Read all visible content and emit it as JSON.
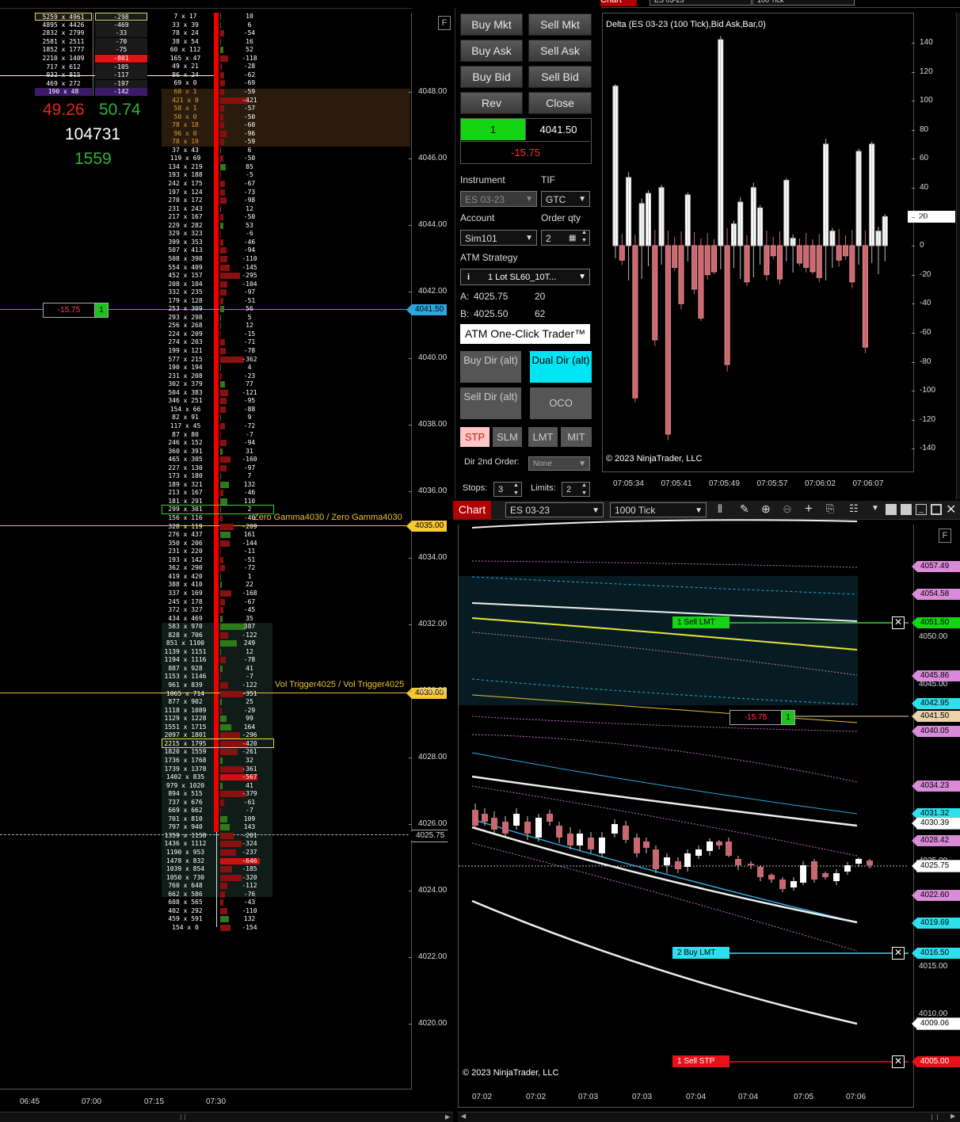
{
  "left_panel": {
    "time_axis": [
      "06:45",
      "07:00",
      "07:15",
      "07:30"
    ],
    "price_axis": [
      "4048.00",
      "4046.00",
      "4044.00",
      "4042.00",
      "4040.00",
      "4038.00",
      "4036.00",
      "4034.00",
      "4032.00",
      "4030.00",
      "4028.00",
      "4026.00",
      "4024.00",
      "4022.00",
      "4020.00"
    ],
    "current_price": "4041.50",
    "last_price": "4025.75",
    "zero_gamma_price": "4035.00",
    "vol_trigger_price": "4030.00",
    "zero_gamma_label": "Zero Gamma4030 / Zero Gamma4030",
    "vol_trigger_label": "Vol Trigger4025 / Vol Trigger4025",
    "position_pnl": "-15.75",
    "position_qty": "1",
    "f_button": "F",
    "stats": {
      "sell_pct": "49.26",
      "buy_pct": "50.74",
      "volume": "104731",
      "delta_total": "1559"
    },
    "time_and_sales": [
      {
        "bidask": "5259 x 4961",
        "delta": "-298"
      },
      {
        "bidask": "4895 x 4426",
        "delta": "-469"
      },
      {
        "bidask": "2832 x 2799",
        "delta": "-33"
      },
      {
        "bidask": "2581 x 2511",
        "delta": "-70"
      },
      {
        "bidask": "1852 x 1777",
        "delta": "-75"
      },
      {
        "bidask": "2210 x 1409",
        "delta": "-801"
      },
      {
        "bidask": "717 x 612",
        "delta": "-105"
      },
      {
        "bidask": "932 x 815",
        "delta": "-117"
      },
      {
        "bidask": "469 x 272",
        "delta": "-197"
      },
      {
        "bidask": "190 x 48",
        "delta": "-142"
      }
    ],
    "ladder": [
      {
        "ba": "7 x 17",
        "d": "10"
      },
      {
        "ba": "33 x 39",
        "d": "6"
      },
      {
        "ba": "78 x 24",
        "d": "-54"
      },
      {
        "ba": "38 x 54",
        "d": "16"
      },
      {
        "ba": "60 x 112",
        "d": "52"
      },
      {
        "ba": "165 x 47",
        "d": "-118"
      },
      {
        "ba": "49 x 21",
        "d": "-28"
      },
      {
        "ba": "86 x 24",
        "d": "-62"
      },
      {
        "ba": "69 x 0",
        "d": "-69"
      },
      {
        "ba": "60 x 1",
        "d": "-59"
      },
      {
        "ba": "421 x 0",
        "d": "-421"
      },
      {
        "ba": "58 x 1",
        "d": "-57"
      },
      {
        "ba": "50 x 0",
        "d": "-50"
      },
      {
        "ba": "78 x 18",
        "d": "-60"
      },
      {
        "ba": "96 x 0",
        "d": "-96"
      },
      {
        "ba": "78 x 19",
        "d": "-59"
      },
      {
        "ba": "37 x 43",
        "d": "6"
      },
      {
        "ba": "119 x 69",
        "d": "-50"
      },
      {
        "ba": "134 x 219",
        "d": "85"
      },
      {
        "ba": "193 x 188",
        "d": "-5"
      },
      {
        "ba": "242 x 175",
        "d": "-67"
      },
      {
        "ba": "197 x 124",
        "d": "-73"
      },
      {
        "ba": "270 x 172",
        "d": "-98"
      },
      {
        "ba": "231 x 243",
        "d": "12"
      },
      {
        "ba": "217 x 167",
        "d": "-50"
      },
      {
        "ba": "229 x 282",
        "d": "53"
      },
      {
        "ba": "329 x 323",
        "d": "-6"
      },
      {
        "ba": "399 x 353",
        "d": "-46"
      },
      {
        "ba": "507 x 413",
        "d": "-94"
      },
      {
        "ba": "508 x 398",
        "d": "-110"
      },
      {
        "ba": "554 x 409",
        "d": "-145"
      },
      {
        "ba": "452 x 157",
        "d": "-295"
      },
      {
        "ba": "208 x 104",
        "d": "-104"
      },
      {
        "ba": "332 x 235",
        "d": "-97"
      },
      {
        "ba": "179 x 128",
        "d": "-51"
      },
      {
        "ba": "253 x 309",
        "d": "56"
      },
      {
        "ba": "293 x 298",
        "d": "5"
      },
      {
        "ba": "256 x 268",
        "d": "12"
      },
      {
        "ba": "224 x 209",
        "d": "-15"
      },
      {
        "ba": "274 x 203",
        "d": "-71"
      },
      {
        "ba": "199 x 121",
        "d": "-78"
      },
      {
        "ba": "577 x 215",
        "d": "-362"
      },
      {
        "ba": "190 x 194",
        "d": "4"
      },
      {
        "ba": "231 x 208",
        "d": "-23"
      },
      {
        "ba": "302 x 379",
        "d": "77"
      },
      {
        "ba": "504 x 383",
        "d": "-121"
      },
      {
        "ba": "346 x 251",
        "d": "-95"
      },
      {
        "ba": "154 x 66",
        "d": "-88"
      },
      {
        "ba": "82 x 91",
        "d": "9"
      },
      {
        "ba": "117 x 45",
        "d": "-72"
      },
      {
        "ba": "87 x 80",
        "d": "-7"
      },
      {
        "ba": "246 x 152",
        "d": "-94"
      },
      {
        "ba": "360 x 391",
        "d": "31"
      },
      {
        "ba": "465 x 305",
        "d": "-160"
      },
      {
        "ba": "227 x 130",
        "d": "-97"
      },
      {
        "ba": "173 x 180",
        "d": "7"
      },
      {
        "ba": "189 x 321",
        "d": "132"
      },
      {
        "ba": "213 x 167",
        "d": "-46"
      },
      {
        "ba": "181 x 291",
        "d": "110"
      },
      {
        "ba": "299 x 301",
        "d": "2"
      },
      {
        "ba": "156 x 116",
        "d": "-40"
      },
      {
        "ba": "328 x 119",
        "d": "-209"
      },
      {
        "ba": "276 x 437",
        "d": "161"
      },
      {
        "ba": "350 x 206",
        "d": "-144"
      },
      {
        "ba": "231 x 220",
        "d": "-11"
      },
      {
        "ba": "193 x 142",
        "d": "-51"
      },
      {
        "ba": "362 x 290",
        "d": "-72"
      },
      {
        "ba": "419 x 420",
        "d": "1"
      },
      {
        "ba": "388 x 410",
        "d": "22"
      },
      {
        "ba": "337 x 169",
        "d": "-168"
      },
      {
        "ba": "245 x 178",
        "d": "-67"
      },
      {
        "ba": "372 x 327",
        "d": "-45"
      },
      {
        "ba": "434 x 469",
        "d": "35"
      },
      {
        "ba": "583 x 970",
        "d": "387"
      },
      {
        "ba": "828 x 706",
        "d": "-122"
      },
      {
        "ba": "851 x 1100",
        "d": "249"
      },
      {
        "ba": "1139 x 1151",
        "d": "12"
      },
      {
        "ba": "1194 x 1116",
        "d": "-78"
      },
      {
        "ba": "887 x 928",
        "d": "41"
      },
      {
        "ba": "1153 x 1146",
        "d": "-7"
      },
      {
        "ba": "961 x 839",
        "d": "-122"
      },
      {
        "ba": "1065 x 714",
        "d": "-351"
      },
      {
        "ba": "877 x 902",
        "d": "25"
      },
      {
        "ba": "1118 x 1089",
        "d": "-29"
      },
      {
        "ba": "1129 x 1228",
        "d": "99"
      },
      {
        "ba": "1551 x 1715",
        "d": "164"
      },
      {
        "ba": "2097 x 1801",
        "d": "-296"
      },
      {
        "ba": "2215 x 1795",
        "d": "-420"
      },
      {
        "ba": "1820 x 1559",
        "d": "-261"
      },
      {
        "ba": "1736 x 1768",
        "d": "32"
      },
      {
        "ba": "1739 x 1378",
        "d": "-361"
      },
      {
        "ba": "1402 x 835",
        "d": "-567"
      },
      {
        "ba": "979 x 1020",
        "d": "41"
      },
      {
        "ba": "894 x 515",
        "d": "-379"
      },
      {
        "ba": "737 x 676",
        "d": "-61"
      },
      {
        "ba": "669 x 662",
        "d": "-7"
      },
      {
        "ba": "701 x 810",
        "d": "109"
      },
      {
        "ba": "797 x 940",
        "d": "143"
      },
      {
        "ba": "1359 x 1158",
        "d": "-201"
      },
      {
        "ba": "1436 x 1112",
        "d": "-324"
      },
      {
        "ba": "1190 x 953",
        "d": "-237"
      },
      {
        "ba": "1478 x 832",
        "d": "-646"
      },
      {
        "ba": "1039 x 854",
        "d": "-185"
      },
      {
        "ba": "1050 x 730",
        "d": "-320"
      },
      {
        "ba": "760 x 648",
        "d": "-112"
      },
      {
        "ba": "662 x 586",
        "d": "-76"
      },
      {
        "ba": "608 x 565",
        "d": "-43"
      },
      {
        "ba": "402 x 292",
        "d": "-110"
      },
      {
        "ba": "459 x 591",
        "d": "132"
      },
      {
        "ba": "154 x 0",
        "d": "-154"
      }
    ]
  },
  "trade_panel": {
    "buy_mkt": "Buy Mkt",
    "sell_mkt": "Sell Mkt",
    "buy_ask": "Buy Ask",
    "sell_ask": "Sell Ask",
    "buy_bid": "Buy Bid",
    "sell_bid": "Sell Bid",
    "rev": "Rev",
    "close": "Close",
    "pos_qty": "1",
    "pos_price": "4041.50",
    "pos_pnl": "-15.75",
    "instrument_label": "Instrument",
    "instrument_value": "ES 03-23",
    "tif_label": "TIF",
    "tif_value": "GTC",
    "account_label": "Account",
    "account_value": "Sim101",
    "qty_label": "Order qty",
    "qty_value": "2",
    "atm_label": "ATM Strategy",
    "atm_value": "1 Lot  SL60_10T...",
    "atm_info": "i",
    "ask_label": "A:",
    "ask_price": "4025.75",
    "ask_size": "20",
    "bid_label": "B:",
    "bid_price": "4025.50",
    "bid_size": "62",
    "one_click": "ATM One-Click Trader™",
    "buy_dir": "Buy Dir (alt)",
    "dual_dir": "Dual Dir (alt)",
    "sell_dir": "Sell Dir (alt)",
    "oco": "OCO",
    "stp": "STP",
    "slm": "SLM",
    "lmt": "LMT",
    "mit": "MIT",
    "dir2_label": "Dir 2nd Order:",
    "dir2_value": "None",
    "stops_label": "Stops:",
    "stops_value": "3",
    "limits_label": "Limits:",
    "limits_value": "2"
  },
  "delta_chart": {
    "tab": "Chart",
    "top_instrument": "ES 03-23",
    "top_interval": "100 Tick",
    "title": "Delta (ES 03-23 (100 Tick),Bid Ask,Bar,0)",
    "copyright": "© 2023 NinjaTrader, LLC",
    "current_label": "20",
    "y_ticks": [
      "140",
      "120",
      "100",
      "80",
      "60",
      "40",
      "20",
      "0",
      "-20",
      "-40",
      "-60",
      "-80",
      "-100",
      "-120",
      "-140"
    ],
    "x_ticks": [
      "07:05:34",
      "07:05:41",
      "07:05:49",
      "07:05:57",
      "07:06:02",
      "07:06:07"
    ]
  },
  "chart_data": {
    "type": "bar",
    "title": "Delta (ES 03-23 (100 Tick),Bid Ask,Bar,0)",
    "ylim": [
      -150,
      150
    ],
    "values": [
      110,
      -10,
      47,
      -105,
      29,
      36,
      -65,
      40,
      -130,
      -15,
      -40,
      35,
      -30,
      -50,
      -20,
      -18,
      142,
      -82,
      15,
      30,
      -25,
      40,
      26,
      -20,
      -7,
      -23,
      45,
      5,
      -12,
      -15,
      -18,
      -22,
      70,
      10,
      -10,
      -7,
      -25,
      65,
      -70,
      70,
      10,
      20
    ]
  },
  "price_chart": {
    "tab": "Chart",
    "instrument": "ES 03-23",
    "interval": "1000 Tick",
    "copyright": "© 2023 NinjaTrader, LLC",
    "f_button": "F",
    "x_ticks": [
      "07:02",
      "07:02",
      "07:03",
      "07:03",
      "07:04",
      "07:04",
      "07:05",
      "07:06"
    ],
    "price_axis": [
      "4050.00",
      "4045.00",
      "4025.00",
      "4015.00",
      "4010.00"
    ],
    "tags": [
      {
        "v": "4057.49"
      },
      {
        "v": "4054.58"
      },
      {
        "v": "4051.50"
      },
      {
        "v": "4045.86"
      },
      {
        "v": "4042.95"
      },
      {
        "v": "4041.50"
      },
      {
        "v": "4040.05"
      },
      {
        "v": "4034.23"
      },
      {
        "v": "4031.32"
      },
      {
        "v": "4030.39"
      },
      {
        "v": "4028.42"
      },
      {
        "v": "4025.75"
      },
      {
        "v": "4022.60"
      },
      {
        "v": "4019.69"
      },
      {
        "v": "4016.50"
      },
      {
        "v": "4009.06"
      },
      {
        "v": "4005.00"
      }
    ],
    "sell_lmt": "1  Sell LMT",
    "buy_lmt": "2  Buy LMT",
    "sell_stp": "1  Sell STP",
    "pos_pnl": "-15.75",
    "pos_qty": "1"
  }
}
